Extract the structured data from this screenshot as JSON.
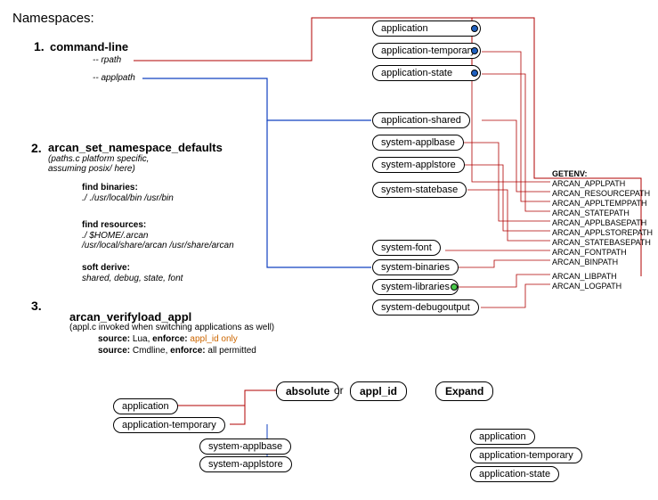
{
  "title": "Namespaces:",
  "sections": {
    "s1": {
      "num": "1.",
      "heading": "command-line",
      "args": [
        "-- rpath",
        "-- applpath"
      ]
    },
    "s2": {
      "num": "2.",
      "heading": "arcan_set_namespace_defaults",
      "sub": "(paths.c platform specific,\nassuming posix/ here)",
      "find_bin_head": "find binaries:",
      "find_bin_text": "./ ./usr/local/bin /usr/bin",
      "find_res_head": "find resources:",
      "find_res_text1": "./ $HOME/.arcan",
      "find_res_text2": "/usr/local/share/arcan /usr/share/arcan",
      "soft_head": "soft derive:",
      "soft_text": "shared, debug, state, font"
    },
    "s3": {
      "num": "3.",
      "heading": "arcan_verifyload_appl",
      "sub": "(appl.c invoked when switching applications as well)",
      "line1a": "source: ",
      "line1b": "Lua, ",
      "line1c": "enforce: ",
      "line1d": "appl_id only",
      "line2a": "source: ",
      "line2b": "Cmdline, ",
      "line2c": "enforce: ",
      "line2d": "all permitted"
    }
  },
  "top_pills": [
    "application",
    "application-temporary",
    "application-state",
    "application-shared",
    "system-applbase",
    "system-applstore",
    "system-statebase",
    "system-font",
    "system-binaries",
    "system-libraries",
    "system-debugoutput"
  ],
  "getenv_head": "GETENV:",
  "getenv": [
    "ARCAN_APPLPATH",
    "ARCAN_RESOURCEPATH",
    "ARCAN_APPLTEMPPATH",
    "ARCAN_STATEPATH",
    "ARCAN_APPLBASEPATH",
    "ARCAN_APPLSTOREPATH",
    "ARCAN_STATEBASEPATH",
    "ARCAN_FONTPATH",
    "ARCAN_BINPATH",
    "ARCAN_LIBPATH",
    "ARCAN_LOGPATH"
  ],
  "bottom": {
    "absolute": "absolute",
    "or": " or ",
    "appl_id": "appl_id",
    "expand": "Expand",
    "left_pills": [
      "application",
      "application-temporary"
    ],
    "sys_pills": [
      "system-applbase",
      "system-applstore"
    ],
    "right_pills": [
      "application",
      "application-temporary",
      "application-state"
    ]
  }
}
